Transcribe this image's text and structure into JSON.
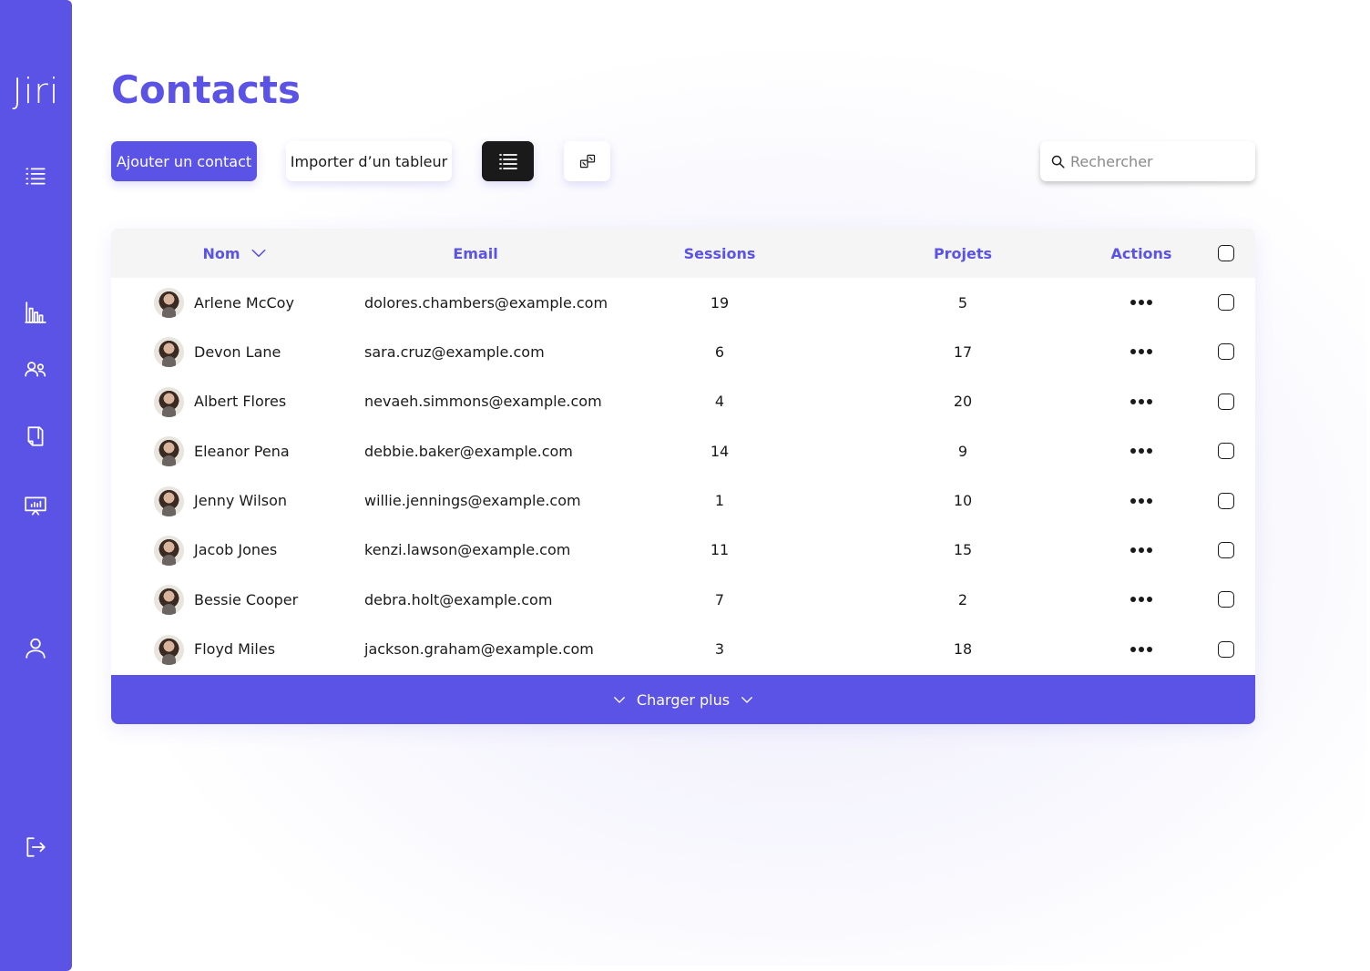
{
  "app": {
    "logo": "Jiri"
  },
  "sidebar": {
    "items": [
      {
        "name": "menu",
        "icon": "menu-icon"
      },
      {
        "name": "stats",
        "icon": "bar-chart-icon"
      },
      {
        "name": "contacts",
        "icon": "users-icon"
      },
      {
        "name": "projects",
        "icon": "document-icon"
      },
      {
        "name": "presentations",
        "icon": "presentation-icon"
      },
      {
        "name": "profile",
        "icon": "user-icon"
      },
      {
        "name": "logout",
        "icon": "logout-icon"
      }
    ]
  },
  "page": {
    "title": "Contacts"
  },
  "toolbar": {
    "add_label": "Ajouter un contact",
    "import_label": "Importer d’un tableur",
    "view_list_icon": "list-view-icon",
    "view_grid_icon": "grid-view-icon"
  },
  "search": {
    "placeholder": "Rechercher",
    "value": ""
  },
  "table": {
    "columns": {
      "name": "Nom",
      "email": "Email",
      "sessions": "Sessions",
      "projects": "Projets",
      "actions": "Actions"
    },
    "sort": {
      "column": "Nom",
      "direction": "desc"
    },
    "rows": [
      {
        "name": "Arlene McCoy",
        "email": "dolores.chambers@example.com",
        "sessions": "19",
        "projects": "5"
      },
      {
        "name": "Devon Lane",
        "email": "sara.cruz@example.com",
        "sessions": "6",
        "projects": "17"
      },
      {
        "name": "Albert Flores",
        "email": "nevaeh.simmons@example.com",
        "sessions": "4",
        "projects": "20"
      },
      {
        "name": "Eleanor Pena",
        "email": "debbie.baker@example.com",
        "sessions": "14",
        "projects": "9"
      },
      {
        "name": "Jenny Wilson",
        "email": "willie.jennings@example.com",
        "sessions": "1",
        "projects": "10"
      },
      {
        "name": "Jacob Jones",
        "email": "kenzi.lawson@example.com",
        "sessions": "11",
        "projects": "15"
      },
      {
        "name": "Bessie Cooper",
        "email": "debra.holt@example.com",
        "sessions": "7",
        "projects": "2"
      },
      {
        "name": "Floyd Miles",
        "email": "jackson.graham@example.com",
        "sessions": "3",
        "projects": "18"
      }
    ],
    "load_more_label": "Charger plus"
  },
  "colors": {
    "accent": "#5b52e6",
    "dark": "#1a1a1a",
    "header_bg": "#f4f5f4"
  }
}
